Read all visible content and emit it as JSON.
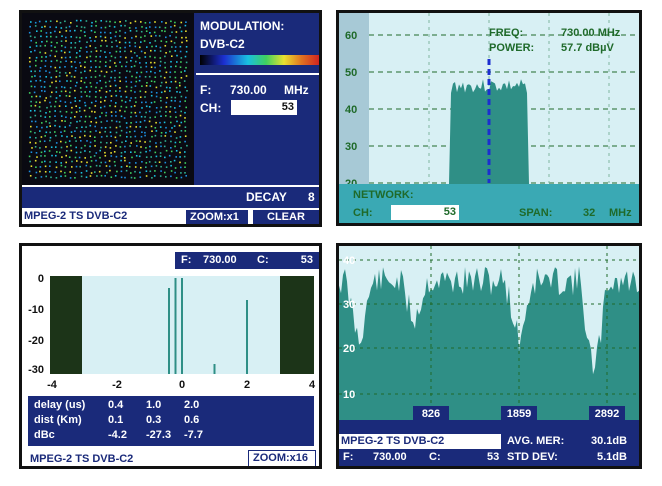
{
  "colors": {
    "navy": "#1a2a7a",
    "panel_bg_light": "#d8f0f4",
    "spectrum_fill": "#2f8f86",
    "dark_block": "#1c3418",
    "text_green": "#1f6a2a",
    "marker": "#1c2fd0"
  },
  "constellation_panel": {
    "modulation_label": "MODULATION:",
    "modulation_value": "DVB-C2",
    "freq_label": "F:",
    "freq_value": "730.00",
    "freq_unit": "MHz",
    "ch_label": "CH:",
    "ch_value": "53",
    "decay_label": "DECAY",
    "decay_value": "8",
    "stream_label": "MPEG-2 TS DVB-C2",
    "zoom_button": "ZOOM:x1",
    "clear_button": "CLEAR"
  },
  "spectrum_panel": {
    "freq_label": "FREQ:",
    "freq_value": "730.00 MHz",
    "power_label": "POWER:",
    "power_value": "57.7  dBµV",
    "network_label": "NETWORK:",
    "ch_label": "CH:",
    "ch_value": "53",
    "span_label": "SPAN:",
    "span_value": "32",
    "span_unit": "MHz",
    "y_ticks": [
      "60",
      "50",
      "40",
      "30",
      "20"
    ]
  },
  "echo_panel": {
    "f_label": "F:",
    "f_value": "730.00",
    "c_label": "C:",
    "c_value": "53",
    "y_ticks": [
      "0",
      "-10",
      "-20",
      "-30"
    ],
    "x_ticks": [
      "-4",
      "-2",
      "0",
      "2",
      "4"
    ],
    "table": {
      "rows": [
        {
          "label": "delay (us)",
          "values": [
            "0.4",
            "1.0",
            "2.0"
          ]
        },
        {
          "label": "dist (Km)",
          "values": [
            "0.1",
            "0.3",
            "0.6"
          ]
        },
        {
          "label": "dBc",
          "values": [
            "-4.2",
            "-27.3",
            "-7.7"
          ]
        }
      ]
    },
    "stream_label": "MPEG-2 TS DVB-C2",
    "zoom_button": "ZOOM:x16"
  },
  "mer_panel": {
    "y_ticks": [
      "40",
      "30",
      "20",
      "10"
    ],
    "carrier_ticks": [
      "826",
      "1859",
      "2892"
    ],
    "stream_label": "MPEG-2 TS DVB-C2",
    "f_label": "F:",
    "f_value": "730.00",
    "c_label": "C:",
    "c_value": "53",
    "avg_mer_label": "AVG. MER:",
    "avg_mer_value": "30.1dB",
    "std_dev_label": "STD DEV:",
    "std_dev_value": "5.1dB"
  }
}
